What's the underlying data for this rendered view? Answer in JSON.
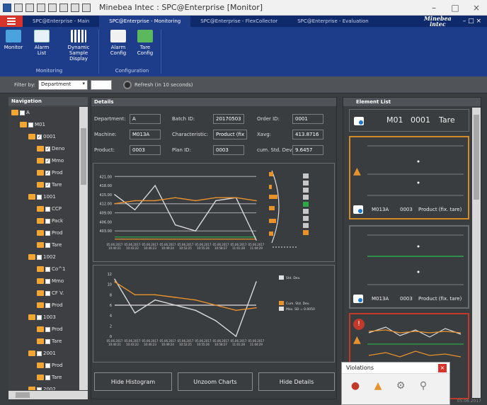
{
  "window": {
    "title": "Minebea Intec : SPC@Enterprise [Monitor]",
    "controls": [
      "–",
      "□",
      "×"
    ]
  },
  "tabs": [
    {
      "label": "SPC@Enterprise - Main",
      "active": false
    },
    {
      "label": "SPC@Enterprise - Monitoring",
      "active": true
    },
    {
      "label": "SPC@Enterprise - FlexCollector",
      "active": false
    },
    {
      "label": "SPC@Enterprise - Evaluation",
      "active": false
    }
  ],
  "brand": {
    "line1": "Minebea",
    "line2": "intec",
    "window_controls": "– □ ×"
  },
  "ribbon": {
    "monitoring": {
      "label": "Monitoring",
      "buttons": [
        {
          "label": "Monitor",
          "icon": "monitor-icon"
        },
        {
          "label": "Alarm List",
          "icon": "alarm-list-icon"
        },
        {
          "label": "Dynamic Sample Display",
          "icon": "sample-display-icon"
        }
      ]
    },
    "configuration": {
      "label": "Configuration",
      "buttons": [
        {
          "label": "Alarm Config",
          "icon": "alarm-config-icon"
        },
        {
          "label": "Tare Config",
          "icon": "tare-config-icon"
        }
      ]
    }
  },
  "filter": {
    "label": "Filter by:",
    "value": "Department",
    "refresh": "Refresh (in 10 seconds)"
  },
  "navigation": {
    "title": "Navigation",
    "items": [
      {
        "label": "A",
        "level": 0,
        "checked": false
      },
      {
        "label": "M01",
        "level": 1,
        "checked": false
      },
      {
        "label": "0001",
        "level": 2,
        "checked": true
      },
      {
        "label": "Deno",
        "level": 3,
        "checked": true
      },
      {
        "label": "Mmo",
        "level": 3,
        "checked": true
      },
      {
        "label": "Prod",
        "level": 3,
        "checked": true
      },
      {
        "label": "Tare",
        "level": 3,
        "checked": true
      },
      {
        "label": "1001",
        "level": 2,
        "checked": false
      },
      {
        "label": "CCP",
        "level": 3,
        "checked": false
      },
      {
        "label": "Pack",
        "level": 3,
        "checked": false
      },
      {
        "label": "Prod",
        "level": 3,
        "checked": false
      },
      {
        "label": "Tare",
        "level": 3,
        "checked": false
      },
      {
        "label": "1002",
        "level": 2,
        "checked": false
      },
      {
        "label": "Co^1",
        "level": 3,
        "checked": false
      },
      {
        "label": "Mmo",
        "level": 3,
        "checked": false
      },
      {
        "label": "CF V.",
        "level": 3,
        "checked": false
      },
      {
        "label": "Prod",
        "level": 3,
        "checked": false
      },
      {
        "label": "1003",
        "level": 2,
        "checked": false
      },
      {
        "label": "Prod",
        "level": 3,
        "checked": false
      },
      {
        "label": "Tare",
        "level": 3,
        "checked": false
      },
      {
        "label": "2001",
        "level": 2,
        "checked": false
      },
      {
        "label": "Prod",
        "level": 3,
        "checked": false
      },
      {
        "label": "Tare",
        "level": 3,
        "checked": false
      },
      {
        "label": "2002",
        "level": 2,
        "checked": false
      }
    ]
  },
  "details": {
    "title": "Details",
    "fields": {
      "department": {
        "label": "Department:",
        "value": "A"
      },
      "batch": {
        "label": "Batch ID:",
        "value": "20170503"
      },
      "order": {
        "label": "Order ID:",
        "value": "0001"
      },
      "machine": {
        "label": "Machine:",
        "value": "M013A"
      },
      "characteristic": {
        "label": "Characteristic:",
        "value": "Product (fix"
      },
      "xavg": {
        "label": "Xavg:",
        "value": "413.8716"
      },
      "product": {
        "label": "Product:",
        "value": "0003"
      },
      "plan": {
        "label": "Plan ID:",
        "value": "0003"
      },
      "cumstd": {
        "label": "cum. Std. Dev.:",
        "value": "9.6457"
      }
    },
    "buttons": {
      "hide_histogram": "Hide Histogram",
      "unzoom": "Unzoom Charts",
      "hide_details": "Hide Details"
    }
  },
  "chart_data": [
    {
      "type": "line",
      "x": [
        "05.06.2017 10:40:21",
        "05.06.2017 10:43:22",
        "05.06.2017 10:46:23",
        "05.06.2017 10:49:24",
        "05.06.2017 10:52:25",
        "05.06.2017 10:55:26",
        "05.06.2017 10:58:27",
        "05.06.2017 11:01:28",
        "05.06.2017 11:04:29"
      ],
      "series": [
        {
          "color": "#d9d9d9",
          "values": [
            415,
            410,
            418,
            405,
            403,
            413,
            414,
            400
          ]
        },
        {
          "color": "#e8922c",
          "values": [
            412,
            413,
            413,
            414,
            413,
            414,
            414,
            413
          ]
        }
      ],
      "yticks": [
        "421.00",
        "418.00",
        "415.00",
        "412.00",
        "409.00",
        "406.00",
        "403.00"
      ],
      "ylim": [
        400,
        422
      ],
      "hlines": [
        {
          "value": 421,
          "color": "#9a9da0"
        },
        {
          "value": 412,
          "color": "#9a9da0"
        },
        {
          "value": 409,
          "color": "#9a9da0"
        },
        {
          "value": 403,
          "color": "#9a9da0"
        },
        {
          "value": 401,
          "color": "#2aa84a"
        },
        {
          "value": 400.3,
          "color": "#e8922c"
        }
      ]
    },
    {
      "type": "line",
      "x": [
        "05.06.2017 10:40:21",
        "05.06.2017 10:43:22",
        "05.06.2017 10:46:23",
        "05.06.2017 10:49:24",
        "05.06.2017 10:52:25",
        "05.06.2017 10:55:26",
        "05.06.2017 10:58:27",
        "05.06.2017 11:01:28",
        "05.06.2017 11:04:29"
      ],
      "series": [
        {
          "color": "#d9d9d9",
          "values": [
            11,
            4.5,
            7,
            6,
            5,
            3,
            0,
            10.5
          ]
        },
        {
          "color": "#e8922c",
          "values": [
            10.5,
            8,
            8,
            7.5,
            7,
            6,
            5,
            5.5
          ]
        }
      ],
      "yticks": [
        "12",
        "10",
        "8",
        "6",
        "4",
        "2",
        "0"
      ],
      "ylim": [
        0,
        12
      ],
      "hlines": [
        {
          "value": 6,
          "color": "#e0e0e0"
        }
      ],
      "legend": [
        {
          "label": "Std. Dev.",
          "color": "#e0e0e0"
        },
        {
          "label": "Cum. Std. Dev.",
          "color": "#e8922c"
        },
        {
          "label": "Max. SD = 0.0050",
          "color": "#e0e0e0"
        }
      ]
    }
  ],
  "element_list": {
    "title": "Element List",
    "header": {
      "m": "M01",
      "n": "0001",
      "c": "Tare"
    },
    "cards": [
      {
        "machine": "M013A",
        "plan": "0003",
        "char": "Product (fix. tare)",
        "border": "orange"
      },
      {
        "machine": "M013A",
        "plan": "0003",
        "char": "Product (fix. tare)",
        "border": "grey"
      },
      {
        "machine": "",
        "plan": "",
        "char": "",
        "border": "red"
      }
    ]
  },
  "violations": {
    "title": "Violations"
  },
  "timestamp": "05.06.2017"
}
